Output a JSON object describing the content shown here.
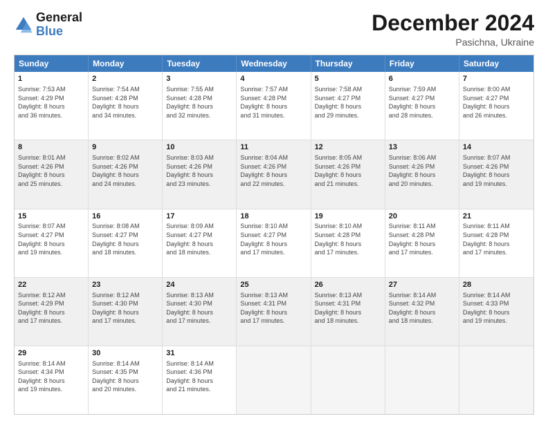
{
  "logo": {
    "text_general": "General",
    "text_blue": "Blue"
  },
  "header": {
    "title": "December 2024",
    "subtitle": "Pasichna, Ukraine"
  },
  "calendar": {
    "days_of_week": [
      "Sunday",
      "Monday",
      "Tuesday",
      "Wednesday",
      "Thursday",
      "Friday",
      "Saturday"
    ],
    "weeks": [
      [
        {
          "day": "1",
          "info": "Sunrise: 7:53 AM\nSunset: 4:29 PM\nDaylight: 8 hours\nand 36 minutes."
        },
        {
          "day": "2",
          "info": "Sunrise: 7:54 AM\nSunset: 4:28 PM\nDaylight: 8 hours\nand 34 minutes."
        },
        {
          "day": "3",
          "info": "Sunrise: 7:55 AM\nSunset: 4:28 PM\nDaylight: 8 hours\nand 32 minutes."
        },
        {
          "day": "4",
          "info": "Sunrise: 7:57 AM\nSunset: 4:28 PM\nDaylight: 8 hours\nand 31 minutes."
        },
        {
          "day": "5",
          "info": "Sunrise: 7:58 AM\nSunset: 4:27 PM\nDaylight: 8 hours\nand 29 minutes."
        },
        {
          "day": "6",
          "info": "Sunrise: 7:59 AM\nSunset: 4:27 PM\nDaylight: 8 hours\nand 28 minutes."
        },
        {
          "day": "7",
          "info": "Sunrise: 8:00 AM\nSunset: 4:27 PM\nDaylight: 8 hours\nand 26 minutes."
        }
      ],
      [
        {
          "day": "8",
          "info": "Sunrise: 8:01 AM\nSunset: 4:26 PM\nDaylight: 8 hours\nand 25 minutes."
        },
        {
          "day": "9",
          "info": "Sunrise: 8:02 AM\nSunset: 4:26 PM\nDaylight: 8 hours\nand 24 minutes."
        },
        {
          "day": "10",
          "info": "Sunrise: 8:03 AM\nSunset: 4:26 PM\nDaylight: 8 hours\nand 23 minutes."
        },
        {
          "day": "11",
          "info": "Sunrise: 8:04 AM\nSunset: 4:26 PM\nDaylight: 8 hours\nand 22 minutes."
        },
        {
          "day": "12",
          "info": "Sunrise: 8:05 AM\nSunset: 4:26 PM\nDaylight: 8 hours\nand 21 minutes."
        },
        {
          "day": "13",
          "info": "Sunrise: 8:06 AM\nSunset: 4:26 PM\nDaylight: 8 hours\nand 20 minutes."
        },
        {
          "day": "14",
          "info": "Sunrise: 8:07 AM\nSunset: 4:26 PM\nDaylight: 8 hours\nand 19 minutes."
        }
      ],
      [
        {
          "day": "15",
          "info": "Sunrise: 8:07 AM\nSunset: 4:27 PM\nDaylight: 8 hours\nand 19 minutes."
        },
        {
          "day": "16",
          "info": "Sunrise: 8:08 AM\nSunset: 4:27 PM\nDaylight: 8 hours\nand 18 minutes."
        },
        {
          "day": "17",
          "info": "Sunrise: 8:09 AM\nSunset: 4:27 PM\nDaylight: 8 hours\nand 18 minutes."
        },
        {
          "day": "18",
          "info": "Sunrise: 8:10 AM\nSunset: 4:27 PM\nDaylight: 8 hours\nand 17 minutes."
        },
        {
          "day": "19",
          "info": "Sunrise: 8:10 AM\nSunset: 4:28 PM\nDaylight: 8 hours\nand 17 minutes."
        },
        {
          "day": "20",
          "info": "Sunrise: 8:11 AM\nSunset: 4:28 PM\nDaylight: 8 hours\nand 17 minutes."
        },
        {
          "day": "21",
          "info": "Sunrise: 8:11 AM\nSunset: 4:28 PM\nDaylight: 8 hours\nand 17 minutes."
        }
      ],
      [
        {
          "day": "22",
          "info": "Sunrise: 8:12 AM\nSunset: 4:29 PM\nDaylight: 8 hours\nand 17 minutes."
        },
        {
          "day": "23",
          "info": "Sunrise: 8:12 AM\nSunset: 4:30 PM\nDaylight: 8 hours\nand 17 minutes."
        },
        {
          "day": "24",
          "info": "Sunrise: 8:13 AM\nSunset: 4:30 PM\nDaylight: 8 hours\nand 17 minutes."
        },
        {
          "day": "25",
          "info": "Sunrise: 8:13 AM\nSunset: 4:31 PM\nDaylight: 8 hours\nand 17 minutes."
        },
        {
          "day": "26",
          "info": "Sunrise: 8:13 AM\nSunset: 4:31 PM\nDaylight: 8 hours\nand 18 minutes."
        },
        {
          "day": "27",
          "info": "Sunrise: 8:14 AM\nSunset: 4:32 PM\nDaylight: 8 hours\nand 18 minutes."
        },
        {
          "day": "28",
          "info": "Sunrise: 8:14 AM\nSunset: 4:33 PM\nDaylight: 8 hours\nand 19 minutes."
        }
      ],
      [
        {
          "day": "29",
          "info": "Sunrise: 8:14 AM\nSunset: 4:34 PM\nDaylight: 8 hours\nand 19 minutes."
        },
        {
          "day": "30",
          "info": "Sunrise: 8:14 AM\nSunset: 4:35 PM\nDaylight: 8 hours\nand 20 minutes."
        },
        {
          "day": "31",
          "info": "Sunrise: 8:14 AM\nSunset: 4:36 PM\nDaylight: 8 hours\nand 21 minutes."
        },
        {
          "day": "",
          "info": ""
        },
        {
          "day": "",
          "info": ""
        },
        {
          "day": "",
          "info": ""
        },
        {
          "day": "",
          "info": ""
        }
      ]
    ]
  }
}
